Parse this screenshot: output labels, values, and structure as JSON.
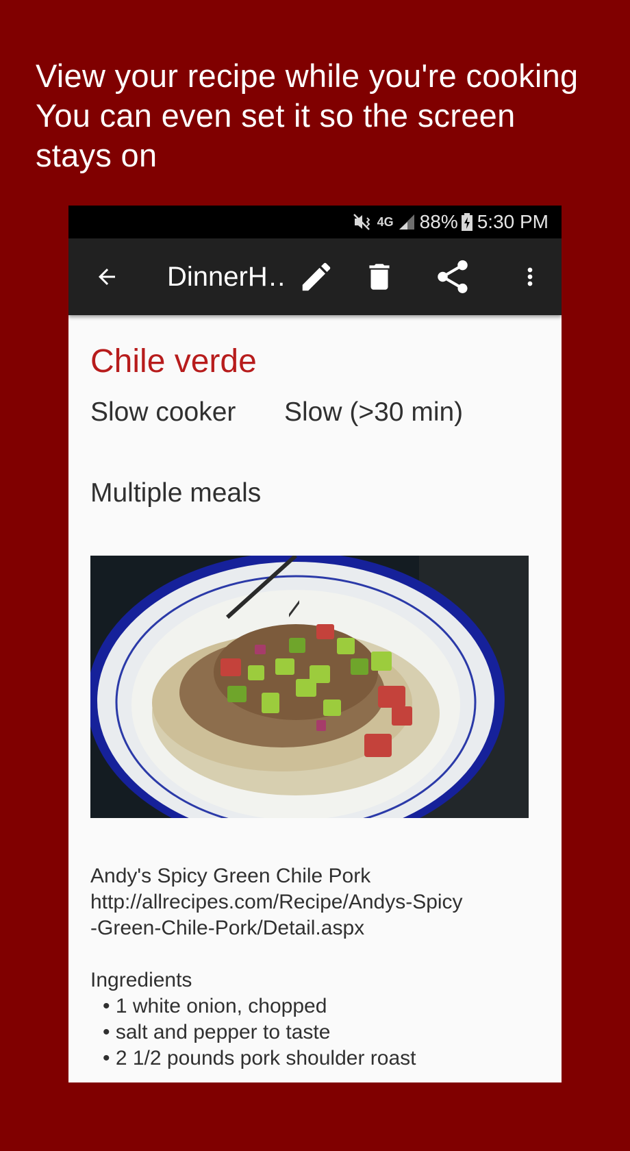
{
  "promo": {
    "lines": [
      "View your recipe while you're cooking",
      "You can even set it so the screen",
      "stays on"
    ]
  },
  "status_bar": {
    "network": "4G",
    "battery": "88%",
    "time": "5:30 PM"
  },
  "toolbar": {
    "title": "DinnerH…",
    "actions": [
      "back-arrow-icon",
      "edit-pencil-icon",
      "delete-trash-icon",
      "share-icon",
      "more-vert-icon"
    ]
  },
  "recipe": {
    "title": "Chile verde",
    "method": "Slow cooker",
    "speed": "Slow (>30 min)",
    "yield": "Multiple meals",
    "notes": {
      "source_name": "Andy's Spicy Green Chile Pork",
      "url_line1": "http://allrecipes.com/Recipe/Andys-Spicy",
      "url_line2": "-Green-Chile-Pork/Detail.aspx",
      "ingredients_header": "Ingredients",
      "ingredients": [
        "1 white onion, chopped",
        "salt and pepper to taste",
        "2 1/2 pounds pork shoulder roast"
      ]
    }
  },
  "colors": {
    "background": "#800000",
    "title_red": "#b71c1c",
    "toolbar": "#212121"
  }
}
